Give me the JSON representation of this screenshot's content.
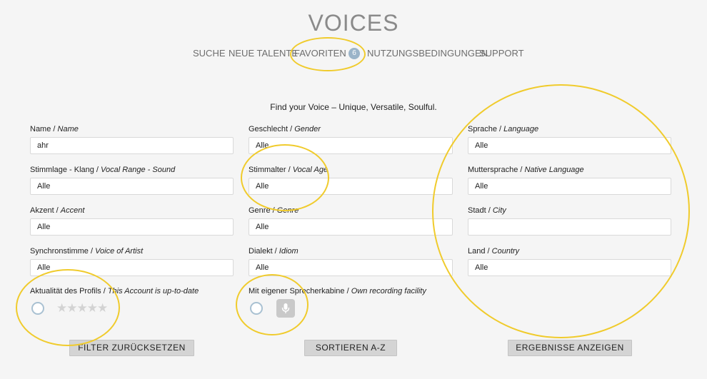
{
  "title": "VOICES",
  "nav": {
    "items": [
      "SUCHE",
      "NEUE TALENTE",
      "FAVORITEN",
      "NUTZUNGSBEDINGUNGEN",
      "SUPPORT"
    ],
    "favorites_count": "6"
  },
  "tagline": "Find your Voice – Unique, Versatile, Soulful.",
  "fields": {
    "name": {
      "label": "Name / ",
      "label_en": "Name",
      "value": "ahr"
    },
    "gender": {
      "label": "Geschlecht / ",
      "label_en": "Gender",
      "value": "Alle"
    },
    "language": {
      "label": "Sprache / ",
      "label_en": "Language",
      "value": "Alle"
    },
    "vocal_range": {
      "label": "Stimmlage - Klang / ",
      "label_en": "Vocal Range - Sound",
      "value": "Alle"
    },
    "vocal_age": {
      "label": "Stimmalter / ",
      "label_en": "Vocal Age",
      "value": "Alle"
    },
    "native_language": {
      "label": "Muttersprache / ",
      "label_en": "Native Language",
      "value": "Alle"
    },
    "accent": {
      "label": "Akzent / ",
      "label_en": "Accent",
      "value": "Alle"
    },
    "genre": {
      "label": "Genre / ",
      "label_en": "Genre",
      "value": "Alle"
    },
    "city": {
      "label": "Stadt / ",
      "label_en": "City",
      "value": ""
    },
    "voice_of_artist": {
      "label": "Synchronstimme / ",
      "label_en": "Voice of Artist",
      "value": "Alle"
    },
    "idiom": {
      "label": "Dialekt / ",
      "label_en": "Idiom",
      "value": "Alle"
    },
    "country": {
      "label": "Land / ",
      "label_en": "Country",
      "value": "Alle"
    }
  },
  "profile_uptodate": {
    "label": "Aktualität des Profils / ",
    "label_en": "This Account is up-to-date",
    "stars": "★★★★★",
    "rating": 0
  },
  "recording_facility": {
    "label": "Mit eigener Sprecherkabine / ",
    "label_en": "Own recording facility"
  },
  "buttons": {
    "reset": "FILTER ZURÜCKSETZEN",
    "sort": "SORTIEREN A-Z",
    "show": "ERGEBNISSE ANZEIGEN"
  },
  "colors": {
    "accent_ring": "#f0cb2c",
    "badge": "#9ab4c9",
    "radio_border": "#a9c1d2"
  }
}
